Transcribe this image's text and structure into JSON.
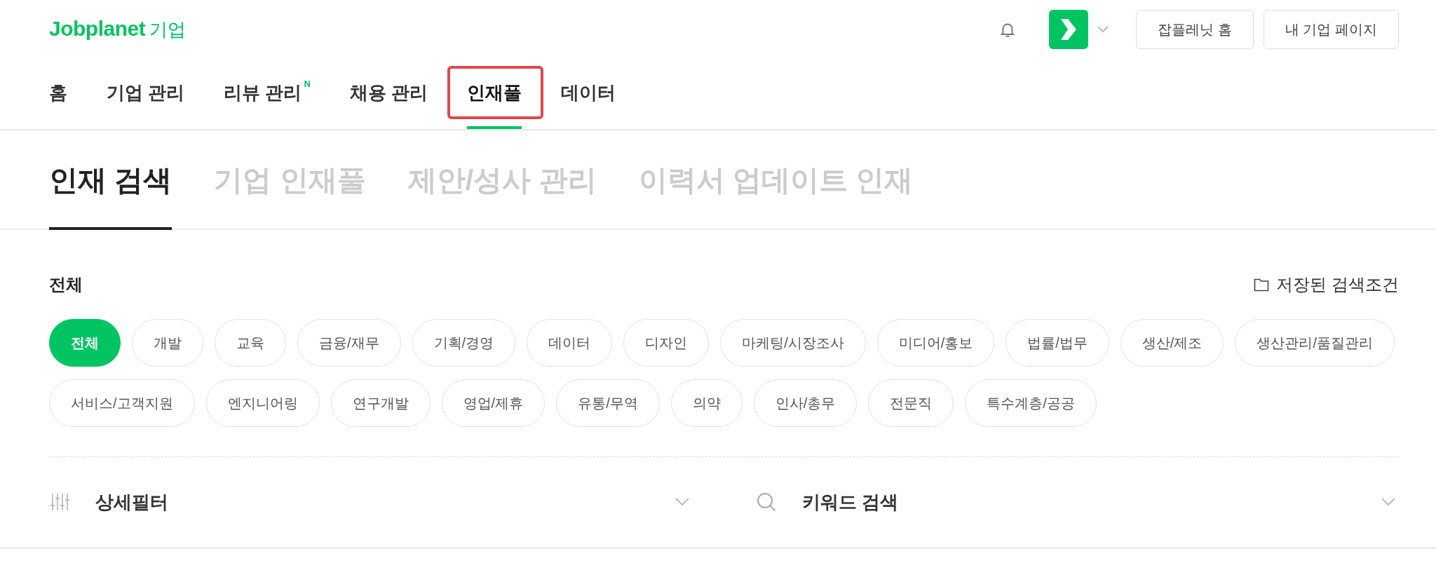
{
  "header": {
    "logo": "Jobplanet",
    "logo_suffix": "기업",
    "buttons": [
      "잡플레닛 홈",
      "내 기업 페이지"
    ]
  },
  "nav": [
    {
      "label": "홈",
      "selected": false,
      "highlighted": false
    },
    {
      "label": "기업 관리",
      "selected": false,
      "highlighted": false
    },
    {
      "label": "리뷰 관리",
      "selected": false,
      "highlighted": false,
      "badge": "N"
    },
    {
      "label": "채용 관리",
      "selected": false,
      "highlighted": false
    },
    {
      "label": "인재풀",
      "selected": true,
      "highlighted": true
    },
    {
      "label": "데이터",
      "selected": false,
      "highlighted": false
    }
  ],
  "subtabs": [
    {
      "label": "인재 검색",
      "selected": true
    },
    {
      "label": "기업 인재풀",
      "selected": false
    },
    {
      "label": "제안/성사 관리",
      "selected": false
    },
    {
      "label": "이력서 업데이트 인재",
      "selected": false
    }
  ],
  "category": {
    "title": "전체",
    "saved_link": "저장된 검색조건",
    "chips": [
      {
        "label": "전체",
        "selected": true
      },
      {
        "label": "개발",
        "selected": false
      },
      {
        "label": "교육",
        "selected": false
      },
      {
        "label": "금융/재무",
        "selected": false
      },
      {
        "label": "기획/경영",
        "selected": false
      },
      {
        "label": "데이터",
        "selected": false
      },
      {
        "label": "디자인",
        "selected": false
      },
      {
        "label": "마케팅/시장조사",
        "selected": false
      },
      {
        "label": "미디어/홍보",
        "selected": false
      },
      {
        "label": "법률/법무",
        "selected": false
      },
      {
        "label": "생산/제조",
        "selected": false
      },
      {
        "label": "생산관리/품질관리",
        "selected": false
      },
      {
        "label": "서비스/고객지원",
        "selected": false
      },
      {
        "label": "엔지니어링",
        "selected": false
      },
      {
        "label": "연구개발",
        "selected": false
      },
      {
        "label": "영업/제휴",
        "selected": false
      },
      {
        "label": "유통/무역",
        "selected": false
      },
      {
        "label": "의약",
        "selected": false
      },
      {
        "label": "인사/총무",
        "selected": false
      },
      {
        "label": "전문직",
        "selected": false
      },
      {
        "label": "특수계층/공공",
        "selected": false
      }
    ]
  },
  "filters": [
    {
      "kind": "filter",
      "label": "상세필터",
      "expanded": false
    },
    {
      "kind": "search",
      "label": "키워드 검색",
      "expanded": false
    }
  ]
}
